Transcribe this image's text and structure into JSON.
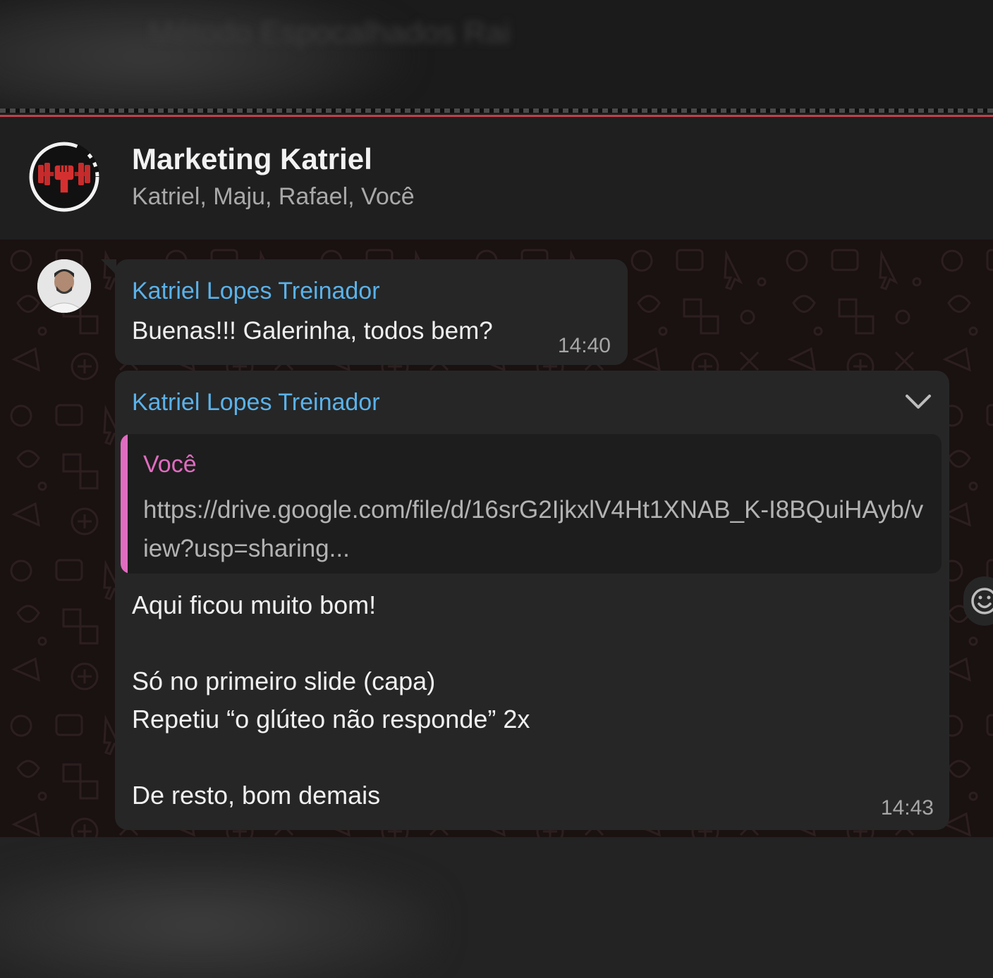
{
  "background": {
    "blurred_title": "Método Espocalhados Rai"
  },
  "chat": {
    "title": "Marketing Katriel",
    "members": "Katriel, Maju, Rafael, Você",
    "accent_color": "#c0404a"
  },
  "messages": [
    {
      "sender": "Katriel Lopes Treinador",
      "text": "Buenas!!! Galerinha, todos bem?",
      "time": "14:40"
    },
    {
      "sender": "Katriel Lopes Treinador",
      "quote": {
        "author": "Você",
        "text": "https://drive.google.com/file/d/16srG2IjkxlV4Ht1XNAB_K-I8BQuiHAyb/view?usp=sharing..."
      },
      "lines": [
        "Aqui ficou muito bom!",
        "Só no primeiro slide (capa)",
        "Repetiu “o glúteo não responde” 2x",
        "De resto, bom demais"
      ],
      "time": "14:43"
    }
  ],
  "icons": {
    "group_avatar": "dumbbell-fist-logo-icon",
    "message_menu": "chevron-down-icon",
    "reaction": "emoji-smile-icon"
  },
  "colors": {
    "sender_name": "#5ab2ea",
    "quote_author": "#e06cc0",
    "bubble": "#262626"
  }
}
